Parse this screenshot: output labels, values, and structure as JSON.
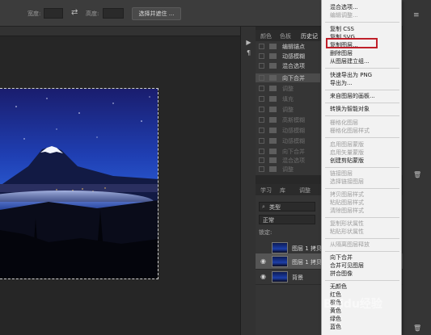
{
  "options_bar": {
    "width_label": "宽度:",
    "height_label": "高度:",
    "select_mask_label": "选择并遮住 ..."
  },
  "panel_tabs_top": {
    "tabs": [
      "颜色",
      "色板",
      "历史记"
    ]
  },
  "history": {
    "items": [
      {
        "label": "编辑锚点",
        "dim": false
      },
      {
        "label": "动感模糊",
        "dim": false
      },
      {
        "label": "混合选项",
        "dim": false
      },
      {
        "label": "向下合并",
        "dim": false,
        "selected": true
      },
      {
        "label": "调整",
        "dim": true
      },
      {
        "label": "填充",
        "dim": true
      },
      {
        "label": "调整",
        "dim": true
      },
      {
        "label": "高斯模糊",
        "dim": true
      },
      {
        "label": "动感模糊",
        "dim": true
      },
      {
        "label": "动感模糊",
        "dim": true
      },
      {
        "label": "向下合并",
        "dim": true
      },
      {
        "label": "混合选项",
        "dim": true
      },
      {
        "label": "调整",
        "dim": true
      }
    ]
  },
  "panel_tabs_layers": {
    "tabs": [
      "学习",
      "库",
      "调整"
    ]
  },
  "layers_panel": {
    "kind_label": "类型",
    "blend_mode": "正常",
    "lock_label": "锁定:",
    "layers": [
      {
        "name": "图层 1 拷贝",
        "visible": false,
        "selected": false
      },
      {
        "name": "图层 1 拷贝",
        "visible": true,
        "selected": true
      },
      {
        "name": "背景",
        "visible": true,
        "selected": false
      }
    ]
  },
  "context_menu": {
    "groups": [
      [
        {
          "label": "混合选项...",
          "disabled": false
        },
        {
          "label": "编辑调整...",
          "disabled": true
        }
      ],
      [
        {
          "label": "复制 CSS",
          "disabled": false
        },
        {
          "label": "复制 SVG",
          "disabled": false
        },
        {
          "label": "复制图层...",
          "disabled": false
        },
        {
          "label": "删除图层",
          "disabled": false
        },
        {
          "label": "从图层建立组...",
          "disabled": false
        }
      ],
      [
        {
          "label": "快速导出为 PNG",
          "disabled": false
        },
        {
          "label": "导出为...",
          "disabled": false
        }
      ],
      [
        {
          "label": "来自图层的画板...",
          "disabled": false
        }
      ],
      [
        {
          "label": "转换为智能对象",
          "disabled": false
        }
      ],
      [
        {
          "label": "栅格化图层",
          "disabled": true
        },
        {
          "label": "栅格化图层样式",
          "disabled": true
        }
      ],
      [
        {
          "label": "启用图层蒙版",
          "disabled": true
        },
        {
          "label": "启用矢量蒙版",
          "disabled": true
        },
        {
          "label": "创建剪贴蒙版",
          "disabled": false
        }
      ],
      [
        {
          "label": "链接图层",
          "disabled": true
        },
        {
          "label": "选择链接图层",
          "disabled": true
        }
      ],
      [
        {
          "label": "拷贝图层样式",
          "disabled": true
        },
        {
          "label": "粘贴图层样式",
          "disabled": true
        },
        {
          "label": "清除图层样式",
          "disabled": true
        }
      ],
      [
        {
          "label": "复制形状属性",
          "disabled": true
        },
        {
          "label": "粘贴形状属性",
          "disabled": true
        }
      ],
      [
        {
          "label": "从隔离图层释放",
          "disabled": true
        }
      ],
      [
        {
          "label": "向下合并",
          "disabled": false
        },
        {
          "label": "合并可见图层",
          "disabled": false
        },
        {
          "label": "拼合图像",
          "disabled": false
        }
      ],
      [
        {
          "label": "无颜色",
          "disabled": false
        },
        {
          "label": "红色",
          "disabled": false
        },
        {
          "label": "橙色",
          "disabled": false
        },
        {
          "label": "黄色",
          "disabled": false
        },
        {
          "label": "绿色",
          "disabled": false
        },
        {
          "label": "蓝色",
          "disabled": false
        }
      ]
    ],
    "highlighted_item": "复制图层..."
  },
  "watermark": "Baidu经验",
  "colors": {
    "highlight_border": "#c0202a",
    "menu_bg": "#f2f2f2",
    "panel_bg": "#353535"
  }
}
